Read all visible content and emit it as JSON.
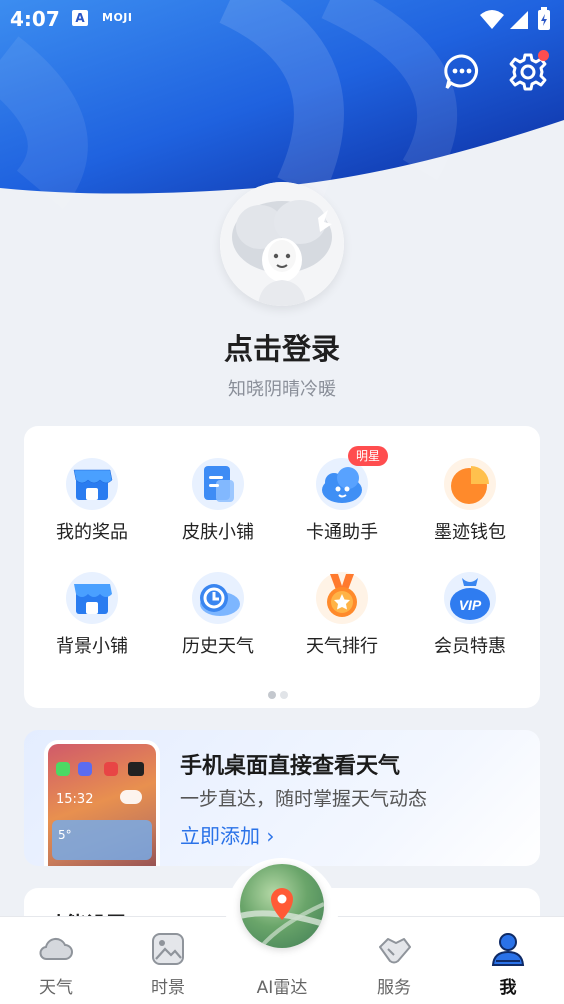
{
  "status_bar": {
    "time": "4:07",
    "app_icon_letter": "A",
    "app_name": "MOJI"
  },
  "header": {
    "chat_icon": "chat-bubble-icon",
    "settings_icon": "gear-icon",
    "settings_has_notification": true
  },
  "profile": {
    "title": "点击登录",
    "subtitle": "知晓阴晴冷暖"
  },
  "grid": {
    "items": [
      {
        "label": "我的奖品",
        "icon": "shop-icon"
      },
      {
        "label": "皮肤小铺",
        "icon": "skin-doc-icon"
      },
      {
        "label": "卡通助手",
        "icon": "cartoon-cloud-icon",
        "badge": "明星"
      },
      {
        "label": "墨迹钱包",
        "icon": "wallet-pie-icon"
      },
      {
        "label": "背景小铺",
        "icon": "shop-icon"
      },
      {
        "label": "历史天气",
        "icon": "history-cloud-icon"
      },
      {
        "label": "天气排行",
        "icon": "medal-icon"
      },
      {
        "label": "会员特惠",
        "icon": "vip-bag-icon"
      }
    ],
    "page_count": 2,
    "active_page": 1
  },
  "promo": {
    "title": "手机桌面直接查看天气",
    "subtitle": "一步直达，随时掌握天气动态",
    "cta": "立即添加",
    "phone_clock": "15:32",
    "phone_temp": "5°"
  },
  "next_section": {
    "title": "功能设置"
  },
  "tabbar": {
    "tabs": [
      {
        "label": "天气",
        "icon": "cloud-icon",
        "active": false
      },
      {
        "label": "时景",
        "icon": "image-icon",
        "active": false
      },
      {
        "label": "AI雷达",
        "icon": "radar-map-icon",
        "active": false
      },
      {
        "label": "服务",
        "icon": "handshake-icon",
        "active": false
      },
      {
        "label": "我",
        "icon": "person-icon",
        "active": true
      }
    ]
  },
  "colors": {
    "brand_blue": "#2a56c6",
    "accent_blue": "#2a72e8",
    "badge_red": "#ff4d4f",
    "background": "#eef1f6"
  }
}
